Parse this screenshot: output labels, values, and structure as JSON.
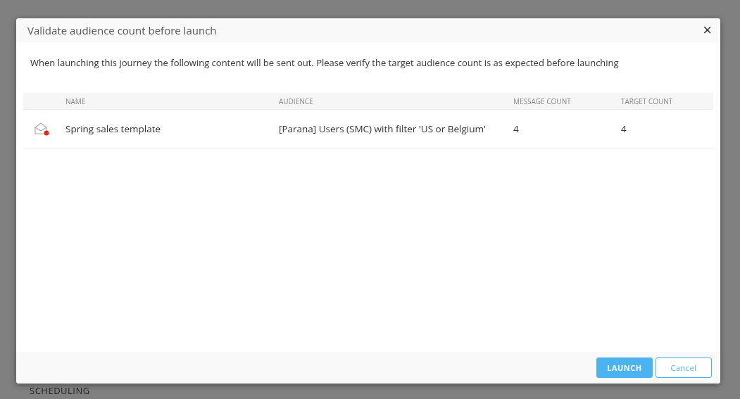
{
  "background": {
    "section_heading": "SCHEDULING"
  },
  "dialog": {
    "title": "Validate audience count before launch",
    "close": "×",
    "message": "When launching this journey the following content will be sent out. Please verify the target audience count is as expected before launching",
    "table": {
      "columns": [
        "NAME",
        "AUDIENCE",
        "MESSAGE COUNT",
        "TARGET COUNT"
      ],
      "rows": [
        {
          "kind": "email",
          "name": "Spring sales template",
          "audience": "[Parana] Users (SMC) with filter 'US or Belgium'",
          "message_count": "4",
          "target_count": "4"
        }
      ]
    },
    "buttons": [
      {
        "kind": "primary",
        "label": "LAUNCH"
      },
      {
        "kind": "secondary",
        "label": "Cancel"
      }
    ]
  }
}
